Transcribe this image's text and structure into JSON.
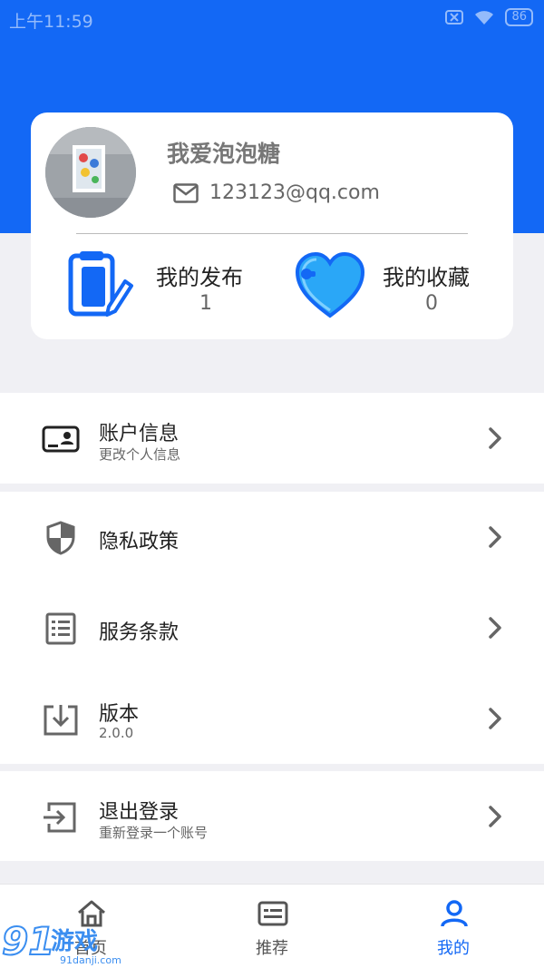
{
  "status_bar": {
    "time": "上午11:59",
    "battery": "86"
  },
  "profile": {
    "username": "我爱泡泡糖",
    "email": "123123@qq.com"
  },
  "stats": [
    {
      "title": "我的发布",
      "count": "1",
      "icon": "clipboard-edit-icon"
    },
    {
      "title": "我的收藏",
      "count": "0",
      "icon": "heart-icon"
    }
  ],
  "menu": {
    "account": {
      "label": "账户信息",
      "sub": "更改个人信息",
      "icon": "id-card-icon"
    },
    "privacy": {
      "label": "隐私政策",
      "icon": "shield-icon"
    },
    "terms": {
      "label": "服务条款",
      "icon": "list-icon"
    },
    "version": {
      "label": "版本",
      "sub": "2.0.0",
      "icon": "download-box-icon"
    },
    "logout": {
      "label": "退出登录",
      "sub": "重新登录一个账号",
      "icon": "logout-icon"
    }
  },
  "tabs": [
    {
      "label": "首页",
      "icon": "home-icon"
    },
    {
      "label": "推荐",
      "icon": "news-icon"
    },
    {
      "label": "我的",
      "icon": "person-icon",
      "active": true
    }
  ],
  "watermark": {
    "text": "91游戏",
    "sub": "91danji.com"
  },
  "colors": {
    "primary": "#1368f5",
    "background": "#f0f0f4",
    "heart": "#2aa7f7"
  }
}
